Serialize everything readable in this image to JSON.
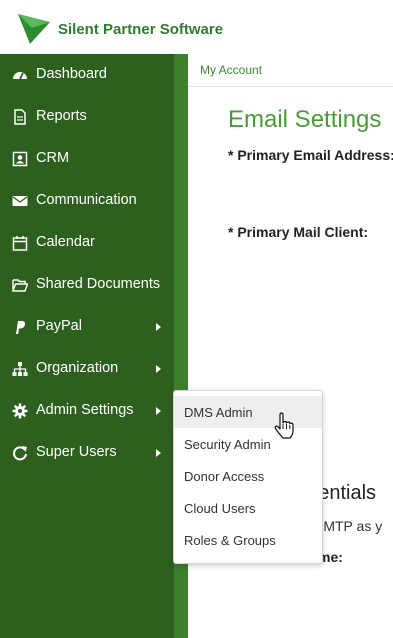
{
  "header": {
    "brand": "Silent Partner Software"
  },
  "sidebar": {
    "items": [
      {
        "label": "Dashboard",
        "icon": "dashboard-icon"
      },
      {
        "label": "Reports",
        "icon": "file-icon"
      },
      {
        "label": "CRM",
        "icon": "contact-card-icon"
      },
      {
        "label": "Communication",
        "icon": "envelope-icon"
      },
      {
        "label": "Calendar",
        "icon": "calendar-icon"
      },
      {
        "label": "Shared Documents",
        "icon": "folder-open-icon"
      },
      {
        "label": "PayPal",
        "icon": "paypal-icon",
        "has_submenu": true
      },
      {
        "label": "Organization",
        "icon": "sitemap-icon",
        "has_submenu": true
      },
      {
        "label": "Admin Settings",
        "icon": "gear-icon",
        "has_submenu": true,
        "expanded": true
      },
      {
        "label": "Super Users",
        "icon": "refresh-icon",
        "has_submenu": true
      }
    ]
  },
  "breadcrumb": "My Account",
  "main": {
    "title": "Email Settings",
    "primary_email_label": "* Primary Email Address:",
    "primary_mail_client_label": "* Primary Mail Client:",
    "section_heading": "edentials",
    "smtp_text": "l SMTP as y",
    "smtp_username_label": "SMTP Username:"
  },
  "dropdown": {
    "items": [
      "DMS Admin",
      "Security Admin",
      "Donor Access",
      "Cloud Users",
      "Roles & Groups"
    ],
    "hovered": "DMS Admin"
  },
  "colors": {
    "sidebar": "#2d5f1f",
    "sidebar_edge": "#3e7f2c",
    "brand_green": "#2e7d32",
    "title_green": "#4a9a3a"
  }
}
